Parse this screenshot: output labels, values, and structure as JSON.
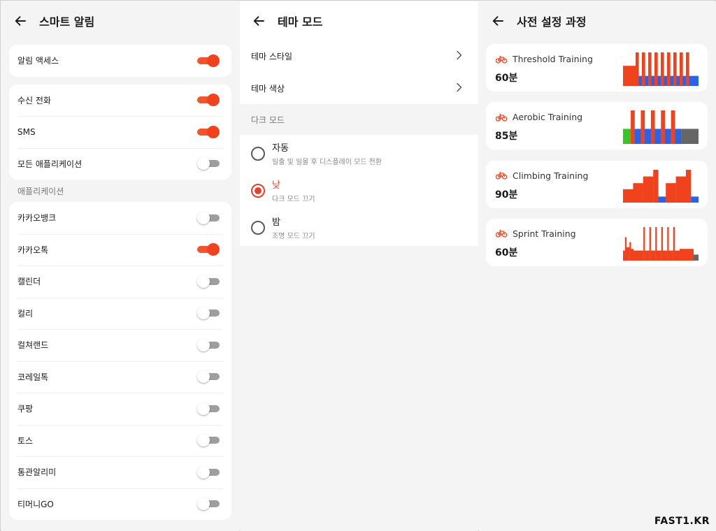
{
  "panel1": {
    "title": "스마트 알림",
    "access": {
      "label": "알림 액세스",
      "on": true
    },
    "basic": [
      {
        "label": "수신 전화",
        "on": true
      },
      {
        "label": "SMS",
        "on": true
      },
      {
        "label": "모든 애플리케이션",
        "on": false
      }
    ],
    "apps_label": "애플리케이션",
    "apps": [
      {
        "label": "카카오뱅크",
        "on": false
      },
      {
        "label": "카카오톡",
        "on": true
      },
      {
        "label": "캘린더",
        "on": false
      },
      {
        "label": "컬리",
        "on": false
      },
      {
        "label": "컬쳐랜드",
        "on": false
      },
      {
        "label": "코레일톡",
        "on": false
      },
      {
        "label": "쿠팡",
        "on": false
      },
      {
        "label": "토스",
        "on": false
      },
      {
        "label": "통관알리미",
        "on": false
      },
      {
        "label": "티머니GO",
        "on": false
      }
    ]
  },
  "panel2": {
    "title": "테마 모드",
    "items": [
      {
        "label": "테마 스타일"
      },
      {
        "label": "테마 색상"
      }
    ],
    "dark_label": "다크 모드",
    "options": [
      {
        "title": "자동",
        "sub": "일출 및 일몰 후 디스플레이 모드 전환",
        "selected": false
      },
      {
        "title": "낮",
        "sub": "다크 모드 끄기",
        "selected": true
      },
      {
        "title": "밤",
        "sub": "조명 모드 끄기",
        "selected": false
      }
    ]
  },
  "panel3": {
    "title": "사전 설정 과정",
    "workouts": [
      {
        "name": "Threshold Training",
        "duration": "60분",
        "segments": [
          {
            "d": 4,
            "v": 0.6,
            "c": "#f0431d"
          },
          {
            "d": 1,
            "v": 1.0,
            "c": "#f0431d"
          },
          {
            "d": 1,
            "v": 0.3,
            "c": "#2a63e6"
          },
          {
            "d": 1,
            "v": 1.0,
            "c": "#f0431d"
          },
          {
            "d": 1,
            "v": 0.3,
            "c": "#2a63e6"
          },
          {
            "d": 1,
            "v": 1.0,
            "c": "#f0431d"
          },
          {
            "d": 1,
            "v": 0.3,
            "c": "#2a63e6"
          },
          {
            "d": 1,
            "v": 1.0,
            "c": "#f0431d"
          },
          {
            "d": 1,
            "v": 0.3,
            "c": "#2a63e6"
          },
          {
            "d": 1,
            "v": 1.0,
            "c": "#f0431d"
          },
          {
            "d": 1,
            "v": 0.3,
            "c": "#2a63e6"
          },
          {
            "d": 1,
            "v": 1.0,
            "c": "#f0431d"
          },
          {
            "d": 1,
            "v": 0.3,
            "c": "#2a63e6"
          },
          {
            "d": 1,
            "v": 1.0,
            "c": "#f0431d"
          },
          {
            "d": 1,
            "v": 0.3,
            "c": "#2a63e6"
          },
          {
            "d": 1,
            "v": 1.0,
            "c": "#f0431d"
          },
          {
            "d": 1,
            "v": 0.3,
            "c": "#2a63e6"
          },
          {
            "d": 1,
            "v": 1.0,
            "c": "#f0431d"
          },
          {
            "d": 3,
            "v": 0.3,
            "c": "#2a63e6"
          }
        ]
      },
      {
        "name": "Aerobic Training",
        "duration": "85분",
        "segments": [
          {
            "d": 2,
            "v": 0.45,
            "c": "#3ac524"
          },
          {
            "d": 1,
            "v": 1.0,
            "c": "#f0431d"
          },
          {
            "d": 1.6,
            "v": 0.45,
            "c": "#2a63e6"
          },
          {
            "d": 1,
            "v": 1.0,
            "c": "#f0431d"
          },
          {
            "d": 1.6,
            "v": 0.45,
            "c": "#2a63e6"
          },
          {
            "d": 1,
            "v": 1.0,
            "c": "#f0431d"
          },
          {
            "d": 1.6,
            "v": 0.45,
            "c": "#2a63e6"
          },
          {
            "d": 1,
            "v": 1.0,
            "c": "#f0431d"
          },
          {
            "d": 1.6,
            "v": 0.45,
            "c": "#2a63e6"
          },
          {
            "d": 1,
            "v": 1.0,
            "c": "#f0431d"
          },
          {
            "d": 1.6,
            "v": 0.45,
            "c": "#2a63e6"
          },
          {
            "d": 4.5,
            "v": 0.45,
            "c": "#666666"
          }
        ]
      },
      {
        "name": "Climbing Training",
        "duration": "90분",
        "segments": [
          {
            "d": 2,
            "v": 0.4,
            "c": "#f0431d"
          },
          {
            "d": 2,
            "v": 0.58,
            "c": "#f0431d"
          },
          {
            "d": 2,
            "v": 0.78,
            "c": "#f0431d"
          },
          {
            "d": 1,
            "v": 0.98,
            "c": "#f0431d"
          },
          {
            "d": 1.5,
            "v": 0.18,
            "c": "#2a63e6"
          },
          {
            "d": 2,
            "v": 0.58,
            "c": "#f0431d"
          },
          {
            "d": 2,
            "v": 0.78,
            "c": "#f0431d"
          },
          {
            "d": 1,
            "v": 0.98,
            "c": "#f0431d"
          },
          {
            "d": 1.5,
            "v": 0.18,
            "c": "#2a63e6"
          }
        ]
      },
      {
        "name": "Sprint Training",
        "duration": "60분",
        "segments": [
          {
            "d": 0.4,
            "v": 0.3,
            "c": "#f0431d"
          },
          {
            "d": 0.3,
            "v": 0.7,
            "c": "#f0431d"
          },
          {
            "d": 0.6,
            "v": 0.4,
            "c": "#f0431d"
          },
          {
            "d": 0.3,
            "v": 0.55,
            "c": "#f0431d"
          },
          {
            "d": 0.5,
            "v": 0.35,
            "c": "#f0431d"
          },
          {
            "d": 2,
            "v": 0.3,
            "c": "#f0431d"
          },
          {
            "d": 0.3,
            "v": 1.0,
            "c": "#f0431d"
          },
          {
            "d": 0.9,
            "v": 0.3,
            "c": "#f0431d"
          },
          {
            "d": 0.3,
            "v": 1.0,
            "c": "#f0431d"
          },
          {
            "d": 0.9,
            "v": 0.3,
            "c": "#f0431d"
          },
          {
            "d": 0.3,
            "v": 1.0,
            "c": "#f0431d"
          },
          {
            "d": 0.9,
            "v": 0.3,
            "c": "#f0431d"
          },
          {
            "d": 0.3,
            "v": 1.0,
            "c": "#f0431d"
          },
          {
            "d": 0.9,
            "v": 0.3,
            "c": "#f0431d"
          },
          {
            "d": 0.3,
            "v": 1.0,
            "c": "#f0431d"
          },
          {
            "d": 0.9,
            "v": 0.3,
            "c": "#f0431d"
          },
          {
            "d": 0.3,
            "v": 1.0,
            "c": "#f0431d"
          },
          {
            "d": 1,
            "v": 0.3,
            "c": "#f0431d"
          },
          {
            "d": 2.8,
            "v": 0.35,
            "c": "#f0431d"
          },
          {
            "d": 1,
            "v": 0.18,
            "c": "#666666"
          }
        ]
      }
    ]
  },
  "watermark": "FAST1.KR"
}
